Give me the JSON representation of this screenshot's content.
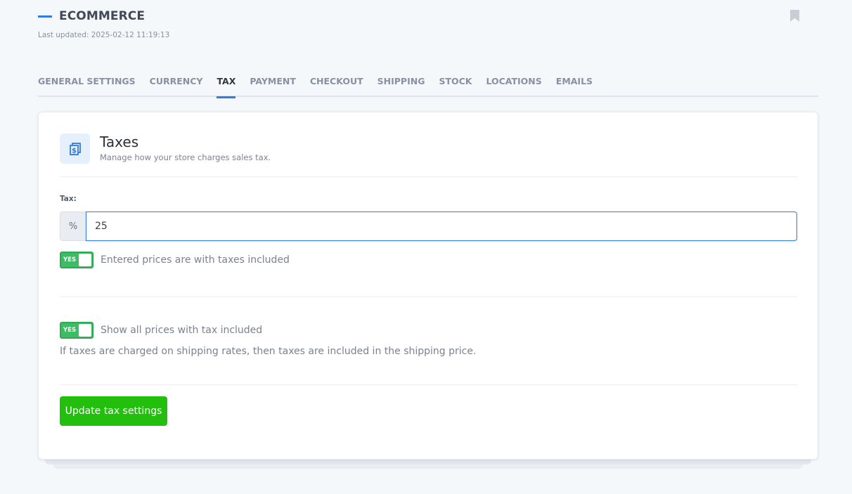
{
  "header": {
    "title": "ECOMMERCE",
    "last_updated": "Last updated: 2025-02-12 11:19:13",
    "accent_color": "#2f7de1"
  },
  "tabs": [
    {
      "label": "GENERAL SETTINGS",
      "active": false
    },
    {
      "label": "CURRENCY",
      "active": false
    },
    {
      "label": "TAX",
      "active": true
    },
    {
      "label": "PAYMENT",
      "active": false
    },
    {
      "label": "CHECKOUT",
      "active": false
    },
    {
      "label": "SHIPPING",
      "active": false
    },
    {
      "label": "STOCK",
      "active": false
    },
    {
      "label": "LOCATIONS",
      "active": false
    },
    {
      "label": "EMAILS",
      "active": false
    }
  ],
  "section": {
    "icon": "receipt-dollar-icon",
    "title": "Taxes",
    "subtitle": "Manage how your store charges sales tax."
  },
  "tax_field": {
    "label": "Tax:",
    "addon": "%",
    "value": "25"
  },
  "toggles": [
    {
      "state_label": "YES",
      "on": true,
      "text": "Entered prices are with taxes included"
    },
    {
      "state_label": "YES",
      "on": true,
      "text": "Show all prices with tax included"
    }
  ],
  "help_text": "If taxes are charged on shipping rates, then taxes are included in the shipping price.",
  "actions": {
    "update_label": "Update tax settings",
    "update_color": "#22bf0c"
  }
}
